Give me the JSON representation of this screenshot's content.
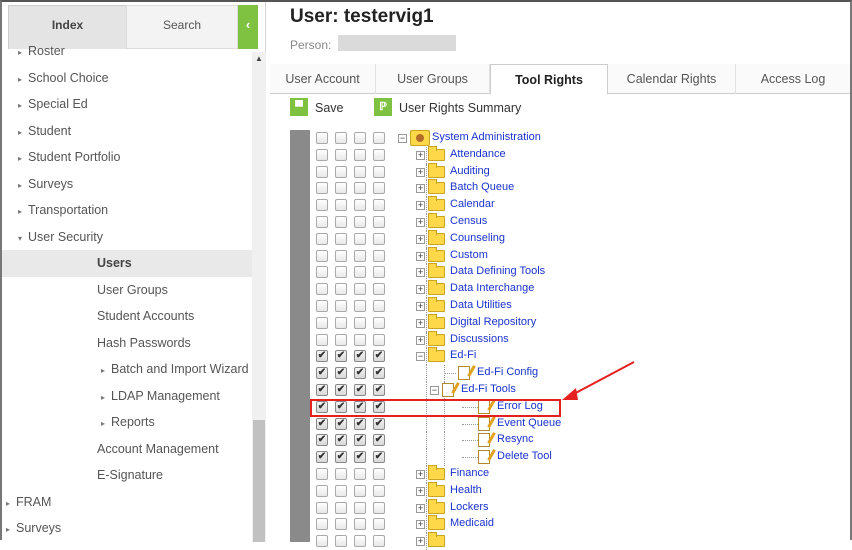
{
  "sidebar": {
    "tab_index": "Index",
    "tab_search": "Search",
    "collapse_glyph": "‹",
    "scroll_up_glyph": "▲",
    "items": [
      {
        "label": "Roster",
        "level": 1,
        "arrow": "▸"
      },
      {
        "label": "School Choice",
        "level": 1,
        "arrow": "▸"
      },
      {
        "label": "Special Ed",
        "level": 1,
        "arrow": "▸"
      },
      {
        "label": "Student",
        "level": 1,
        "arrow": "▸"
      },
      {
        "label": "Student Portfolio",
        "level": 1,
        "arrow": "▸"
      },
      {
        "label": "Surveys",
        "level": 1,
        "arrow": "▸"
      },
      {
        "label": "Transportation",
        "level": 1,
        "arrow": "▸"
      },
      {
        "label": "User Security",
        "level": 1,
        "arrow": "▾"
      },
      {
        "label": "Users",
        "level": 2,
        "arrow": "",
        "active": true
      },
      {
        "label": "User Groups",
        "level": 2,
        "arrow": ""
      },
      {
        "label": "Student Accounts",
        "level": 2,
        "arrow": ""
      },
      {
        "label": "Hash Passwords",
        "level": 2,
        "arrow": ""
      },
      {
        "label": "Batch and Import Wizard",
        "level": 3,
        "arrow": "▸"
      },
      {
        "label": "LDAP Management",
        "level": 3,
        "arrow": "▸"
      },
      {
        "label": "Reports",
        "level": 3,
        "arrow": "▸"
      },
      {
        "label": "Account Management",
        "level": 2,
        "arrow": ""
      },
      {
        "label": "E-Signature",
        "level": 2,
        "arrow": ""
      },
      {
        "label": "FRAM",
        "level": 0,
        "arrow": "▸"
      },
      {
        "label": "Surveys",
        "level": 0,
        "arrow": "▸"
      }
    ]
  },
  "main": {
    "title": "User: testervig1",
    "person_label": "Person:",
    "tabs": [
      "User Account",
      "User Groups",
      "Tool Rights",
      "Calendar Rights",
      "Access Log"
    ],
    "active_tab": "Tool Rights",
    "save_label": "Save",
    "save_icon_glyph": "▀",
    "summary_label": "User Rights Summary",
    "summary_icon_glyph": "ℙ"
  },
  "tree": [
    {
      "label": "System Administration",
      "depth": 0,
      "icon": "system-admin-icon",
      "exp": "−",
      "checks": [
        false,
        false,
        false,
        false
      ]
    },
    {
      "label": "Attendance",
      "depth": 1,
      "icon": "folder-icon",
      "exp": "+",
      "checks": [
        false,
        false,
        false,
        false
      ]
    },
    {
      "label": "Auditing",
      "depth": 1,
      "icon": "folder-icon",
      "exp": "+",
      "checks": [
        false,
        false,
        false,
        false
      ]
    },
    {
      "label": "Batch Queue",
      "depth": 1,
      "icon": "folder-icon",
      "exp": "+",
      "checks": [
        false,
        false,
        false,
        false
      ]
    },
    {
      "label": "Calendar",
      "depth": 1,
      "icon": "folder-icon",
      "exp": "+",
      "checks": [
        false,
        false,
        false,
        false
      ]
    },
    {
      "label": "Census",
      "depth": 1,
      "icon": "folder-icon",
      "exp": "+",
      "checks": [
        false,
        false,
        false,
        false
      ]
    },
    {
      "label": "Counseling",
      "depth": 1,
      "icon": "folder-icon",
      "exp": "+",
      "checks": [
        false,
        false,
        false,
        false
      ]
    },
    {
      "label": "Custom",
      "depth": 1,
      "icon": "folder-icon",
      "exp": "+",
      "checks": [
        false,
        false,
        false,
        false
      ]
    },
    {
      "label": "Data Defining Tools",
      "depth": 1,
      "icon": "folder-icon",
      "exp": "+",
      "checks": [
        false,
        false,
        false,
        false
      ]
    },
    {
      "label": "Data Interchange",
      "depth": 1,
      "icon": "folder-icon",
      "exp": "+",
      "checks": [
        false,
        false,
        false,
        false
      ]
    },
    {
      "label": "Data Utilities",
      "depth": 1,
      "icon": "folder-icon",
      "exp": "+",
      "checks": [
        false,
        false,
        false,
        false
      ]
    },
    {
      "label": "Digital Repository",
      "depth": 1,
      "icon": "folder-icon",
      "exp": "+",
      "checks": [
        false,
        false,
        false,
        false
      ]
    },
    {
      "label": "Discussions",
      "depth": 1,
      "icon": "folder-icon",
      "exp": "+",
      "checks": [
        false,
        false,
        false,
        false
      ]
    },
    {
      "label": "Ed-Fi",
      "depth": 1,
      "icon": "folder-icon",
      "exp": "−",
      "checks": [
        true,
        true,
        true,
        true
      ]
    },
    {
      "label": "Ed-Fi Config",
      "depth": 2,
      "icon": "tool-icon",
      "exp": "",
      "checks": [
        true,
        true,
        true,
        true
      ]
    },
    {
      "label": "Ed-Fi Tools",
      "depth": 2,
      "icon": "tool-icon",
      "exp": "−",
      "checks": [
        true,
        true,
        true,
        true
      ]
    },
    {
      "label": "Error Log",
      "depth": 3,
      "icon": "tool-icon",
      "exp": "",
      "checks": [
        true,
        true,
        true,
        true
      ]
    },
    {
      "label": "Event Queue",
      "depth": 3,
      "icon": "tool-icon",
      "exp": "",
      "checks": [
        true,
        true,
        true,
        true
      ]
    },
    {
      "label": "Resync",
      "depth": 3,
      "icon": "tool-icon",
      "exp": "",
      "checks": [
        true,
        true,
        true,
        true
      ]
    },
    {
      "label": "Delete Tool",
      "depth": 3,
      "icon": "tool-icon",
      "exp": "",
      "checks": [
        true,
        true,
        true,
        true
      ]
    },
    {
      "label": "Finance",
      "depth": 1,
      "icon": "folder-icon",
      "exp": "+",
      "checks": [
        false,
        false,
        false,
        false
      ]
    },
    {
      "label": "Health",
      "depth": 1,
      "icon": "folder-icon",
      "exp": "+",
      "checks": [
        false,
        false,
        false,
        false
      ]
    },
    {
      "label": "Lockers",
      "depth": 1,
      "icon": "folder-icon",
      "exp": "+",
      "checks": [
        false,
        false,
        false,
        false
      ]
    },
    {
      "label": "Medicaid",
      "depth": 1,
      "icon": "folder-icon",
      "exp": "+",
      "checks": [
        false,
        false,
        false,
        false
      ]
    },
    {
      "label": "",
      "depth": 1,
      "icon": "folder-icon",
      "exp": "+",
      "checks": [
        false,
        false,
        false,
        false
      ]
    }
  ],
  "checked_glyph": "✔",
  "highlight_color": "#e52020",
  "accent_color": "#7fc242",
  "link_color": "#1a33cc"
}
